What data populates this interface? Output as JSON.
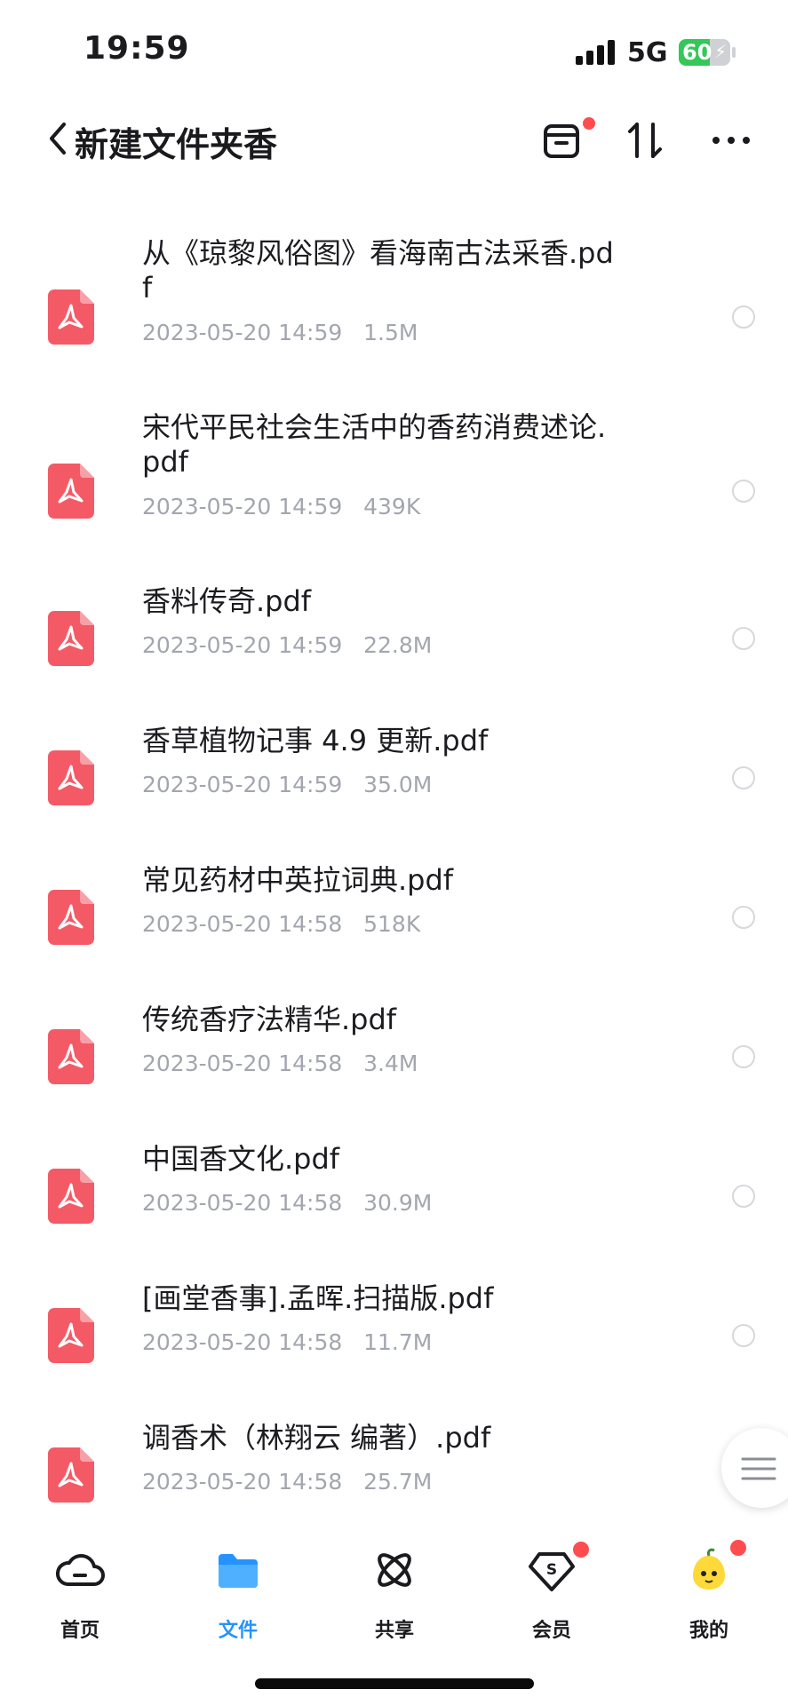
{
  "status": {
    "time": "19:59",
    "network": "5G",
    "battery": "60"
  },
  "header": {
    "title": "新建文件夹香"
  },
  "files": [
    {
      "name": "从《琼黎风俗图》看海南古法采香.pdf",
      "date": "2023-05-20 14:59",
      "size": "1.5M"
    },
    {
      "name": "宋代平民社会生活中的香药消费述论.pdf",
      "date": "2023-05-20 14:59",
      "size": "439K"
    },
    {
      "name": "香料传奇.pdf",
      "date": "2023-05-20 14:59",
      "size": "22.8M"
    },
    {
      "name": "香草植物记事 4.9 更新.pdf",
      "date": "2023-05-20 14:59",
      "size": "35.0M"
    },
    {
      "name": "常见药材中英拉词典.pdf",
      "date": "2023-05-20 14:58",
      "size": "518K"
    },
    {
      "name": "传统香疗法精华.pdf",
      "date": "2023-05-20 14:58",
      "size": "3.4M"
    },
    {
      "name": "中国香文化.pdf",
      "date": "2023-05-20 14:58",
      "size": "30.9M"
    },
    {
      "name": "[画堂香事].孟晖.扫描版.pdf",
      "date": "2023-05-20 14:58",
      "size": "11.7M"
    },
    {
      "name": "调香术（林翔云 编著）.pdf",
      "date": "2023-05-20 14:58",
      "size": "25.7M"
    }
  ],
  "tabs": [
    {
      "label": "首页",
      "icon": "cloud-icon"
    },
    {
      "label": "文件",
      "icon": "folder-icon"
    },
    {
      "label": "共享",
      "icon": "atom-icon"
    },
    {
      "label": "会员",
      "icon": "vip-diamond-icon"
    },
    {
      "label": "我的",
      "icon": "avatar-icon"
    }
  ],
  "colors": {
    "accent": "#2493ff",
    "pdf": "#f45a66",
    "badge": "#ff4d4f",
    "meta": "#a3a6ae"
  }
}
